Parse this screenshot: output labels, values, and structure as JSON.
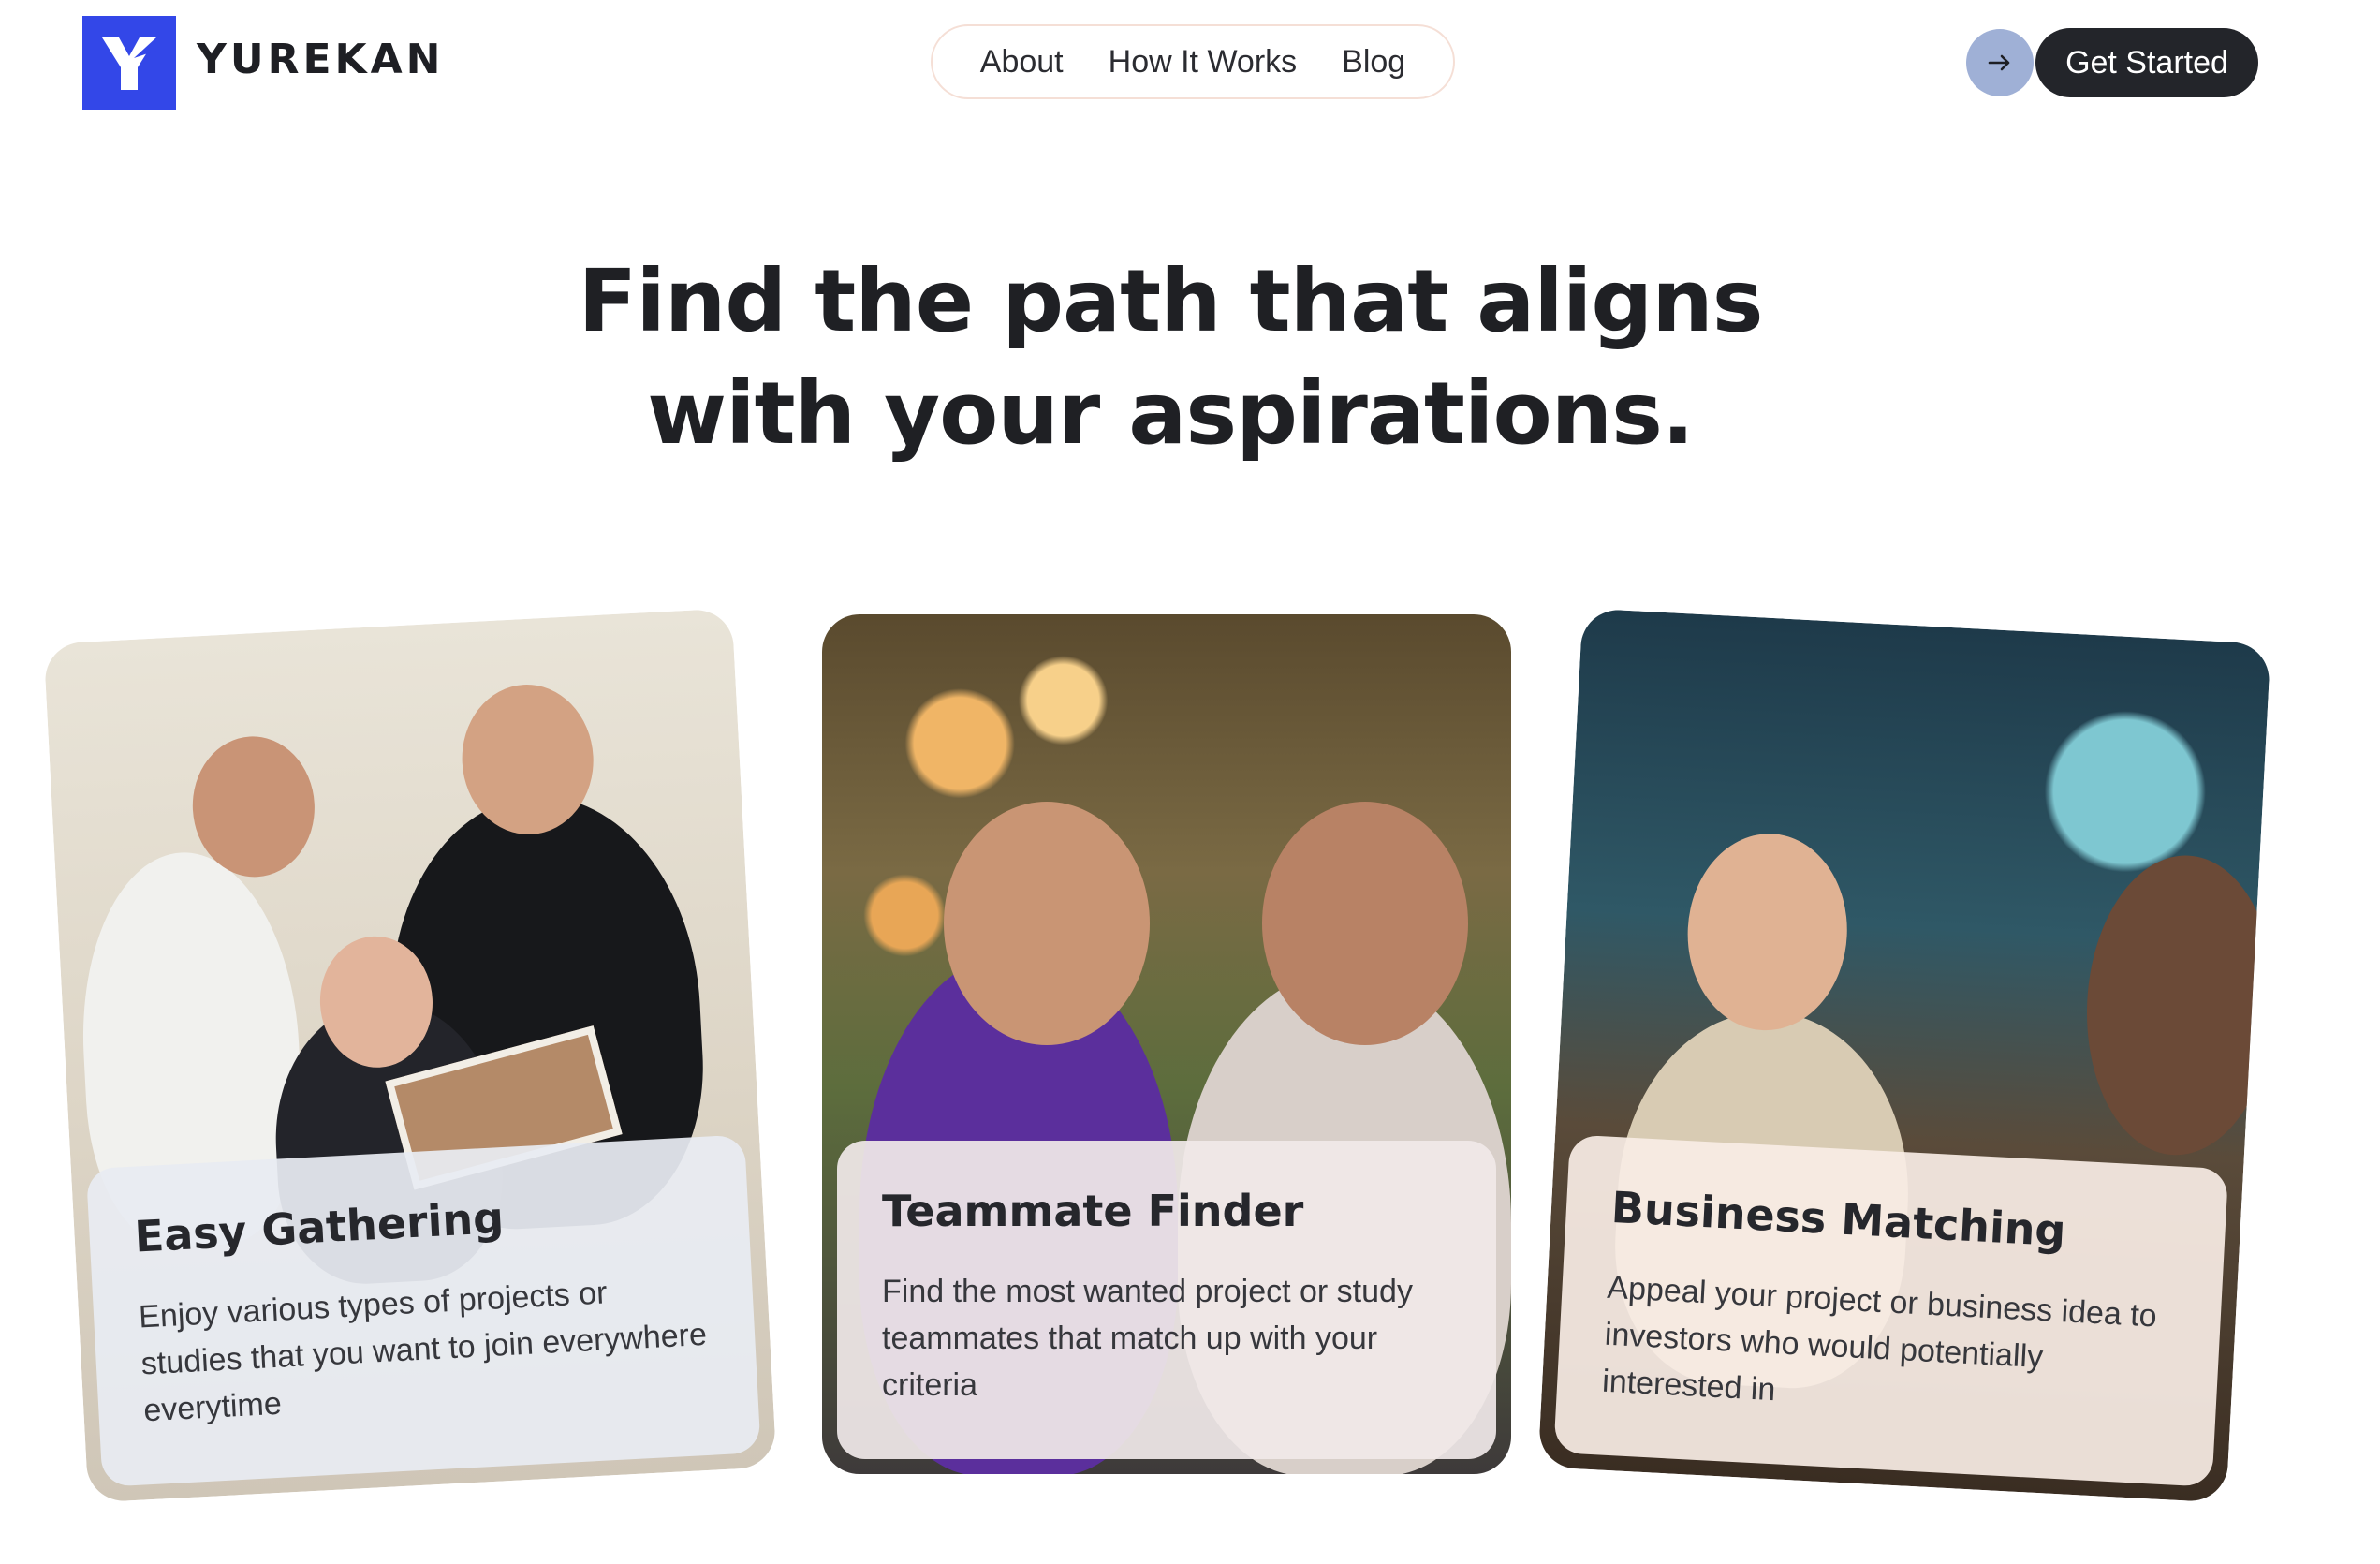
{
  "brand": {
    "name": "YUREKAN",
    "color": "#3347e8"
  },
  "nav": {
    "items": [
      "About",
      "How It Works",
      "Blog"
    ]
  },
  "header": {
    "arrow_icon": "arrow-right-icon",
    "cta_label": "Get Started"
  },
  "hero": {
    "line1": "Find the path that aligns",
    "line2": "with your aspirations."
  },
  "cards": [
    {
      "title": "Easy Gathering",
      "description": "Enjoy various types of projects or studies that you want to join everywhere everytime"
    },
    {
      "title": "Teammate Finder",
      "description": "Find the most wanted project or study teammates that match up with your criteria"
    },
    {
      "title": "Business Matching",
      "description": "Appeal your project or business idea to investors who would potentially interested in"
    }
  ]
}
